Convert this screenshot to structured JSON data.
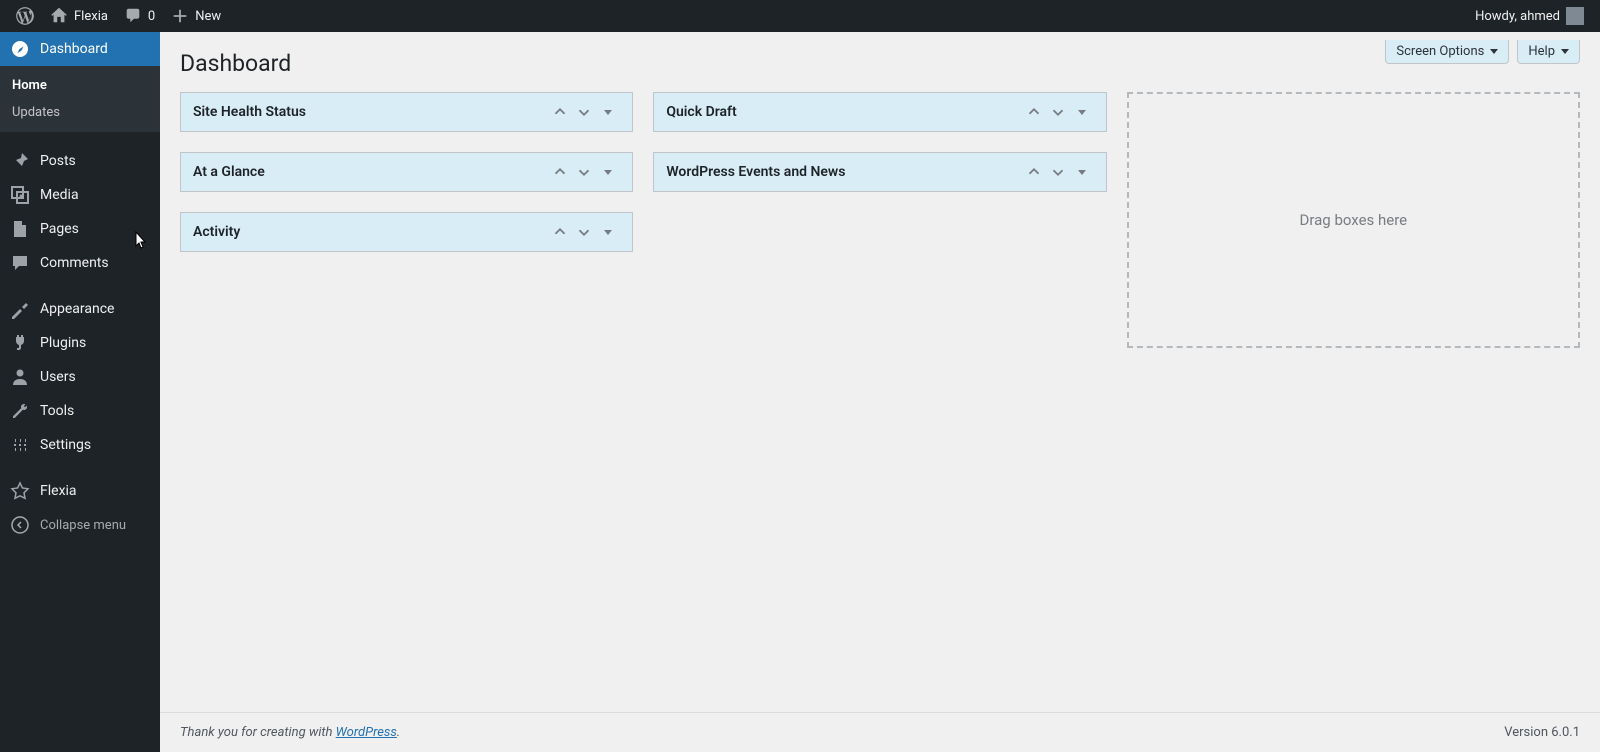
{
  "adminbar": {
    "site_name": "Flexia",
    "comment_count": "0",
    "new_label": "New",
    "greeting": "Howdy, ahmed"
  },
  "sidebar": {
    "dashboard": "Dashboard",
    "submenu": {
      "home": "Home",
      "updates": "Updates"
    },
    "posts": "Posts",
    "media": "Media",
    "pages": "Pages",
    "comments": "Comments",
    "appearance": "Appearance",
    "plugins": "Plugins",
    "users": "Users",
    "tools": "Tools",
    "settings": "Settings",
    "flexia": "Flexia",
    "collapse": "Collapse menu"
  },
  "top_buttons": {
    "screen_options": "Screen Options",
    "help": "Help"
  },
  "page_title": "Dashboard",
  "widgets": {
    "col1": [
      "Site Health Status",
      "At a Glance",
      "Activity"
    ],
    "col2": [
      "Quick Draft",
      "WordPress Events and News"
    ]
  },
  "dropzone_text": "Drag boxes here",
  "footer": {
    "thanks_prefix": "Thank you for creating with ",
    "link_text": "WordPress",
    "period": ".",
    "version": "Version 6.0.1"
  }
}
